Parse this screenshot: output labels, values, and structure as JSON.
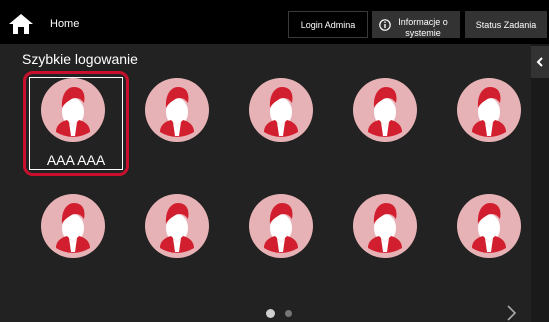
{
  "header": {
    "home_label": "Home",
    "login_admin_label": "Login Admina",
    "info_label_line1": "Informacje o",
    "info_label_line2": "systemie",
    "status_label": "Status Zadania"
  },
  "main": {
    "section_title": "Szybkie logowanie",
    "selected_user_name": "AAA AAA"
  },
  "pagination": {
    "current_page": 1,
    "total_pages": 2
  },
  "icons": {
    "home": "home-icon",
    "info": "info-icon",
    "user": "user-avatar-icon",
    "side_tab": "chevron-left-icon",
    "next": "chevron-right-icon"
  },
  "colors": {
    "accent": "#c8102e",
    "avatar_bg": "#e7b2b6",
    "avatar_head": "#ffffff",
    "avatar_body": "#d11f2f"
  }
}
